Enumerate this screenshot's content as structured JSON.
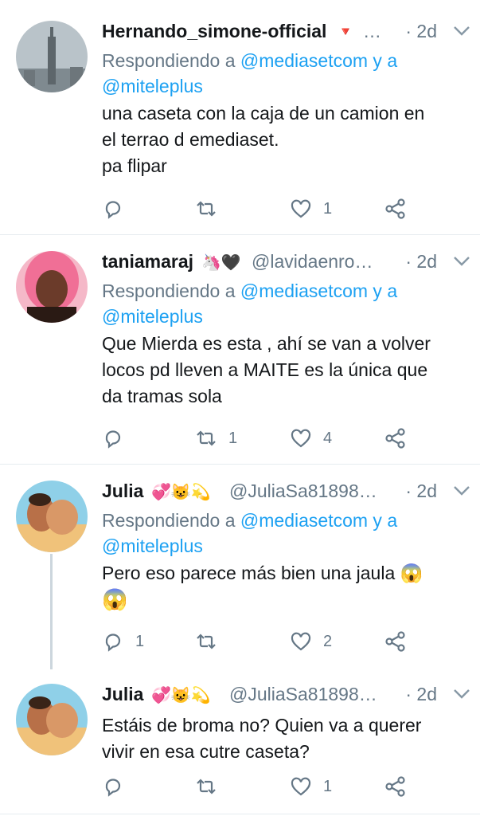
{
  "colors": {
    "link": "#1da1f2",
    "muted": "#657786",
    "text": "#14171a",
    "divider": "#e6ecf0"
  },
  "tweets": [
    {
      "name": "Hernando_simone-official",
      "badge": "🔻",
      "handle": "…",
      "time": "· 2d",
      "reply_prefix": "Respondiendo a ",
      "reply_to_1": "@mediasetcom",
      "reply_and": " y a",
      "reply_to_2": "@miteleplus",
      "lines": [
        "una caseta  con la caja  de un camion en",
        "el terrao  d emediaset.",
        "pa flipar"
      ],
      "replies": "",
      "retweets": "",
      "likes": "1"
    },
    {
      "name": "taniamaraj",
      "emojis": "🦄🖤",
      "handle": "@lavidaenro…",
      "time": "· 2d",
      "reply_prefix": "Respondiendo a ",
      "reply_to_1": "@mediasetcom",
      "reply_and": " y a",
      "reply_to_2": "@miteleplus",
      "lines": [
        "Que Mierda es esta , ahí se van a volver",
        "locos  pd lleven a MAITE es la única que",
        "da tramas sola"
      ],
      "replies": "",
      "retweets": "1",
      "likes": "4"
    },
    {
      "name": "Julia",
      "emojis": "💞😺💫",
      "handle": "@JuliaSa81898…",
      "time": "· 2d",
      "reply_prefix": "Respondiendo a ",
      "reply_to_1": "@mediasetcom",
      "reply_and": " y a",
      "reply_to_2": "@miteleplus",
      "lines": [
        "Pero eso parece más bien una jaula 😱",
        "😱"
      ],
      "replies": "1",
      "retweets": "",
      "likes": "2"
    },
    {
      "name": "Julia",
      "emojis": "💞😺💫",
      "handle": "@JuliaSa81898…",
      "time": "· 2d",
      "lines": [
        "Estáis de broma no? Quien va a querer",
        "vivir en esa cutre caseta?"
      ],
      "replies": "",
      "retweets": "",
      "likes": "1"
    }
  ],
  "icons": [
    "reply-icon",
    "retweet-icon",
    "like-icon",
    "share-icon",
    "chevron-down-icon"
  ]
}
